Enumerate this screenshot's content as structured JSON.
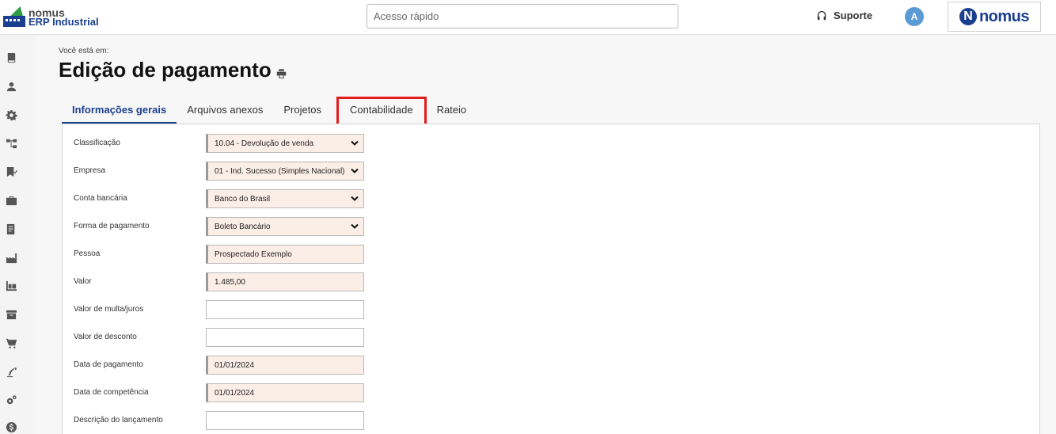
{
  "app": {
    "brand_line1": "nomus",
    "brand_line2": "ERP Industrial",
    "quick_access_placeholder": "Acesso rápido",
    "support_label": "Suporte",
    "avatar_initial": "A",
    "logo_letter": "N",
    "logo_word": "nomus"
  },
  "sidebar": {
    "icons": [
      "book-icon",
      "person-icon",
      "gear-icon",
      "hierarchy-icon",
      "flag-check-icon",
      "briefcase-icon",
      "document-list-icon",
      "factory-icon",
      "pallet-icon",
      "archive-box-icon",
      "cart-icon",
      "robot-arm-icon",
      "gears-icon",
      "dollar-icon"
    ]
  },
  "page": {
    "breadcrumb": "Você está em:",
    "title": "Edição de pagamento"
  },
  "tabs": [
    {
      "label": "Informações gerais",
      "active": true
    },
    {
      "label": "Arquivos anexos",
      "active": false
    },
    {
      "label": "Projetos",
      "active": false
    },
    {
      "label": "Contabilidade",
      "active": false,
      "highlighted": true
    },
    {
      "label": "Rateio",
      "active": false
    }
  ],
  "form": {
    "fields": [
      {
        "label": "Classificação",
        "value": "10.04 - Devolução de venda",
        "type": "select"
      },
      {
        "label": "Empresa",
        "value": "01 - Ind. Sucesso (Simples Nacional)",
        "type": "select"
      },
      {
        "label": "Conta bancária",
        "value": "Banco do Brasil",
        "type": "select"
      },
      {
        "label": "Forma de pagamento",
        "value": "Boleto Bancário",
        "type": "select"
      },
      {
        "label": "Pessoa",
        "value": "Prospectado Exemplo",
        "type": "text"
      },
      {
        "label": "Valor",
        "value": "1.485,00",
        "type": "text"
      },
      {
        "label": "Valor de multa/juros",
        "value": "",
        "type": "text"
      },
      {
        "label": "Valor de desconto",
        "value": "",
        "type": "text"
      },
      {
        "label": "Data de pagamento",
        "value": "01/01/2024",
        "type": "text"
      },
      {
        "label": "Data de competência",
        "value": "01/01/2024",
        "type": "text"
      },
      {
        "label": "Descrição do lançamento",
        "value": "",
        "type": "text"
      }
    ]
  },
  "colors": {
    "brand_blue": "#1b3f8f",
    "highlight_red": "#e31b1b",
    "required_field_bg": "#fbeee6"
  }
}
